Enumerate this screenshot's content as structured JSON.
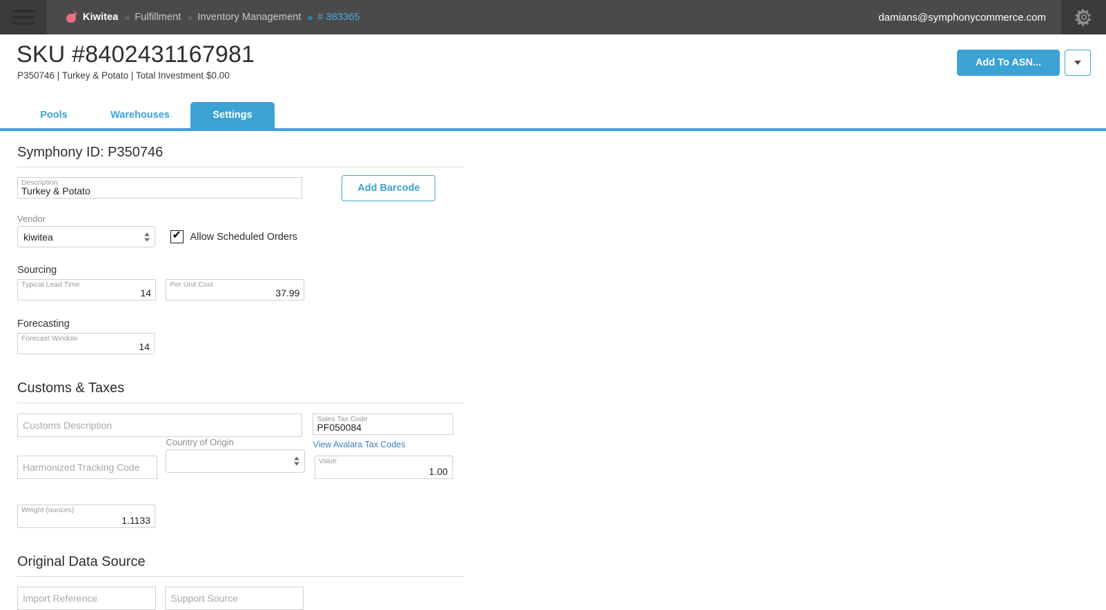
{
  "topbar": {
    "menu_icon": "hamburger-icon",
    "brand_logo": "kiwi-leaf-logo",
    "breadcrumbs": [
      {
        "label": "Kiwitea",
        "style": "brand"
      },
      {
        "label": "Fulfillment",
        "style": "muted"
      },
      {
        "label": "Inventory Management",
        "style": "muted"
      },
      {
        "label": "# 383365",
        "style": "active"
      }
    ],
    "user_email": "damians@symphonycommerce.com",
    "settings_icon": "gear-icon",
    "colors": {
      "bar": "#4a4a4a",
      "accent": "#3ba2d6",
      "active_crumb": "#49a9dd"
    }
  },
  "page_header": {
    "title": "SKU #8402431167981",
    "subtitle": "P350746 | Turkey & Potato | Total Investment $0.00",
    "primary_button": "Add To ASN...",
    "dropdown_icon": "chevron-down-icon"
  },
  "tabs": [
    {
      "label": "Pools",
      "selected": false
    },
    {
      "label": "Warehouses",
      "selected": false
    },
    {
      "label": "Settings",
      "selected": true
    }
  ],
  "settings": {
    "symphony_id_heading": "Symphony ID: P350746",
    "description": {
      "label": "Description",
      "value": "Turkey & Potato"
    },
    "add_barcode_button": "Add Barcode",
    "vendor": {
      "label": "Vendor",
      "value": "kiwitea",
      "options": [
        "kiwitea"
      ]
    },
    "allow_scheduled_orders": {
      "label": "Allow Scheduled Orders",
      "checked": true
    },
    "sourcing": {
      "heading": "Sourcing",
      "lead_time": {
        "label": "Typical Lead Time",
        "value": "14"
      },
      "per_unit_cost": {
        "label": "Per Unit Cost",
        "value": "37.99"
      }
    },
    "forecasting": {
      "heading": "Forecasting",
      "forecast_window": {
        "label": "Forecast Window",
        "value": "14"
      }
    },
    "customs": {
      "heading": "Customs & Taxes",
      "customs_description": {
        "placeholder": "Customs Description",
        "value": ""
      },
      "sales_tax_code": {
        "label": "Sales Tax Code",
        "value": "PF050084"
      },
      "avalara_link": "View Avalara Tax Codes",
      "harmonized_code": {
        "placeholder": "Harmonized Tracking Code",
        "value": ""
      },
      "country_of_origin": {
        "label": "Country of Origin",
        "value": "",
        "options": [
          ""
        ]
      },
      "value": {
        "label": "Value",
        "value": "1.00"
      },
      "weight": {
        "label": "Weight (ounces)",
        "value": "1.1133"
      }
    },
    "original_source": {
      "heading": "Original Data Source",
      "import_reference": {
        "placeholder": "Import Reference",
        "value": ""
      },
      "support_source": {
        "placeholder": "Support Source",
        "value": ""
      }
    }
  }
}
